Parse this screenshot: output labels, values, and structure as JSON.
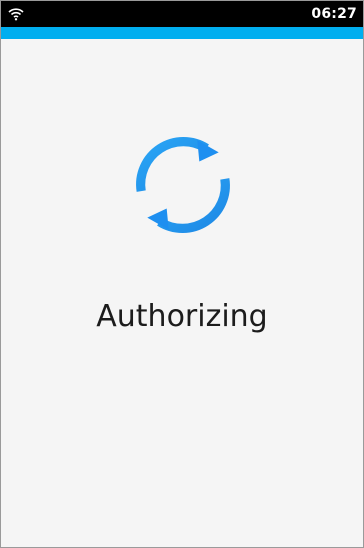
{
  "status_bar": {
    "time": "06:27",
    "wifi_icon": "wifi-icon"
  },
  "colors": {
    "status_bar": "#000000",
    "accent": "#00aeef",
    "background": "#f5f5f5",
    "spinner": "#2196f3",
    "text": "#1c1c1c"
  },
  "main": {
    "spinner_icon": "sync-refresh-icon",
    "message": "Authorizing"
  }
}
